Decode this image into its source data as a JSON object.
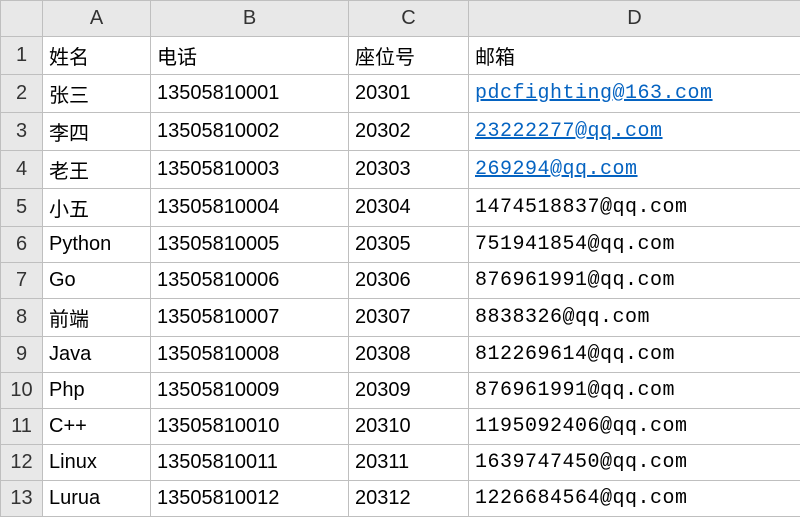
{
  "columns": [
    "A",
    "B",
    "C",
    "D"
  ],
  "headerRow": {
    "rowNum": "1",
    "cells": [
      "姓名",
      "电话",
      "座位号",
      "邮箱"
    ]
  },
  "rows": [
    {
      "rowNum": "2",
      "name": "张三",
      "phone": "13505810001",
      "seat": "20301",
      "email": "pdcfighting@163.com",
      "link": true
    },
    {
      "rowNum": "3",
      "name": "李四",
      "phone": "13505810002",
      "seat": "20302",
      "email": "23222277@qq.com",
      "link": true
    },
    {
      "rowNum": "4",
      "name": "老王",
      "phone": "13505810003",
      "seat": "20303",
      "email": "269294@qq.com",
      "link": true
    },
    {
      "rowNum": "5",
      "name": "小五",
      "phone": "13505810004",
      "seat": "20304",
      "email": "1474518837@qq.com",
      "link": false
    },
    {
      "rowNum": "6",
      "name": "Python",
      "phone": "13505810005",
      "seat": "20305",
      "email": "751941854@qq.com",
      "link": false
    },
    {
      "rowNum": "7",
      "name": "Go",
      "phone": "13505810006",
      "seat": "20306",
      "email": "876961991@qq.com",
      "link": false
    },
    {
      "rowNum": "8",
      "name": "前端",
      "phone": "13505810007",
      "seat": "20307",
      "email": "8838326@qq.com",
      "link": false
    },
    {
      "rowNum": "9",
      "name": "Java",
      "phone": "13505810008",
      "seat": "20308",
      "email": "812269614@qq.com",
      "link": false
    },
    {
      "rowNum": "10",
      "name": "Php",
      "phone": "13505810009",
      "seat": "20309",
      "email": "876961991@qq.com",
      "link": false
    },
    {
      "rowNum": "11",
      "name": "C++",
      "phone": "13505810010",
      "seat": "20310",
      "email": "1195092406@qq.com",
      "link": false
    },
    {
      "rowNum": "12",
      "name": "Linux",
      "phone": "13505810011",
      "seat": "20311",
      "email": "1639747450@qq.com",
      "link": false
    },
    {
      "rowNum": "13",
      "name": "Lurua",
      "phone": "13505810012",
      "seat": "20312",
      "email": "1226684564@qq.com",
      "link": false
    }
  ]
}
